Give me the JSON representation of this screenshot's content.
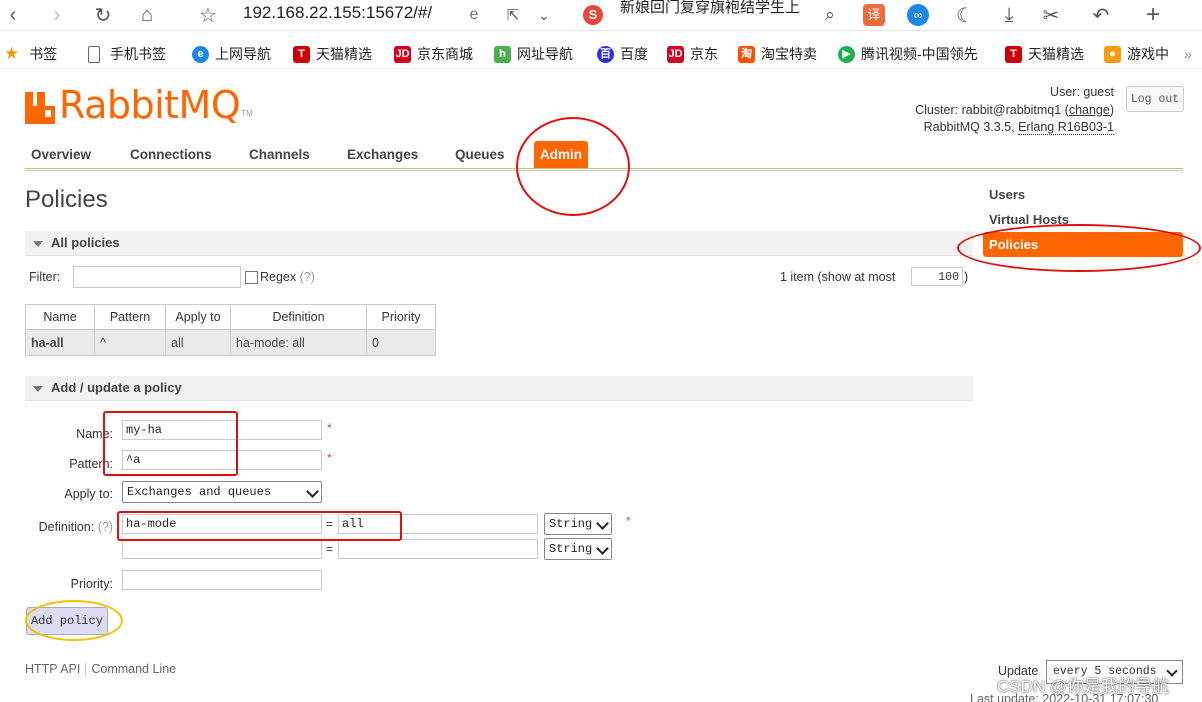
{
  "browser": {
    "address": "192.168.22.155:15672/#/",
    "tab_title": "新娘回门复穿旗袍结学生上",
    "bookmarks": [
      {
        "label": "书签",
        "icon": "star-icon"
      },
      {
        "label": "手机书签",
        "icon": "phone-icon"
      },
      {
        "label": "上网导航",
        "icon": "ie-icon"
      },
      {
        "label": "天猫精选",
        "icon": "tmall-icon"
      },
      {
        "label": "京东商城",
        "icon": "jd-icon"
      },
      {
        "label": "网址导航",
        "icon": "hao-icon"
      },
      {
        "label": "百度",
        "icon": "baidu-icon"
      },
      {
        "label": "京东",
        "icon": "jd-icon"
      },
      {
        "label": "淘宝特卖",
        "icon": "taobao-icon"
      },
      {
        "label": "腾讯视频-中国领先",
        "icon": "tencent-video-icon"
      },
      {
        "label": "天猫精选",
        "icon": "tmall-icon"
      },
      {
        "label": "游戏中",
        "icon": "game-icon"
      }
    ]
  },
  "app": {
    "logo": "RabbitMQ",
    "user_label": "User:",
    "user": "guest",
    "cluster_label": "Cluster:",
    "cluster": "rabbit@rabbitmq1",
    "change_link": "change",
    "version_prefix": "RabbitMQ 3.3.5,",
    "erlang": "Erlang R16B03-1",
    "logout": "Log out"
  },
  "tabs": [
    "Overview",
    "Connections",
    "Channels",
    "Exchanges",
    "Queues",
    "Admin"
  ],
  "active_tab": "Admin",
  "sidenav": [
    "Users",
    "Virtual Hosts",
    "Policies"
  ],
  "page_title": "Policies",
  "all_policies": {
    "header": "All policies",
    "filter_label": "Filter:",
    "regex_label": "Regex",
    "regex_hint": "(?)",
    "items_text": "1 item (show at most",
    "items_max": "100",
    "items_paren": ")",
    "columns": [
      "Name",
      "Pattern",
      "Apply to",
      "Definition",
      "Priority"
    ],
    "rows": [
      {
        "name": "ha-all",
        "pattern": "^",
        "apply_to": "all",
        "definition": "ha-mode: all",
        "priority": "0"
      }
    ]
  },
  "add_policy": {
    "header": "Add / update a policy",
    "name_label": "Name:",
    "name_value": "my-ha",
    "pattern_label": "Pattern:",
    "pattern_value": "^a",
    "apply_label": "Apply to:",
    "apply_value": "Exchanges and queues",
    "definition_label": "Definition:",
    "definition_hint": "(?)",
    "def_rows": [
      {
        "key": "ha-mode",
        "value": "all",
        "type": "String"
      },
      {
        "key": "",
        "value": "",
        "type": "String"
      }
    ],
    "priority_label": "Priority:",
    "priority_value": "",
    "submit": "Add policy",
    "required_mark": "*",
    "equals": "="
  },
  "footer": {
    "http_api": "HTTP API",
    "command_line": "Command Line",
    "update_label": "Update",
    "update_value": "every 5 seconds",
    "last_update": "Last update: 2022-10-31 17:07:30"
  },
  "watermark": "CSDN @你是我的导航",
  "colors": {
    "accent": "#ff6600",
    "annotation_red": "#e01010",
    "annotation_yellow": "#f2c200",
    "button_bg": "#dcdcf2"
  }
}
